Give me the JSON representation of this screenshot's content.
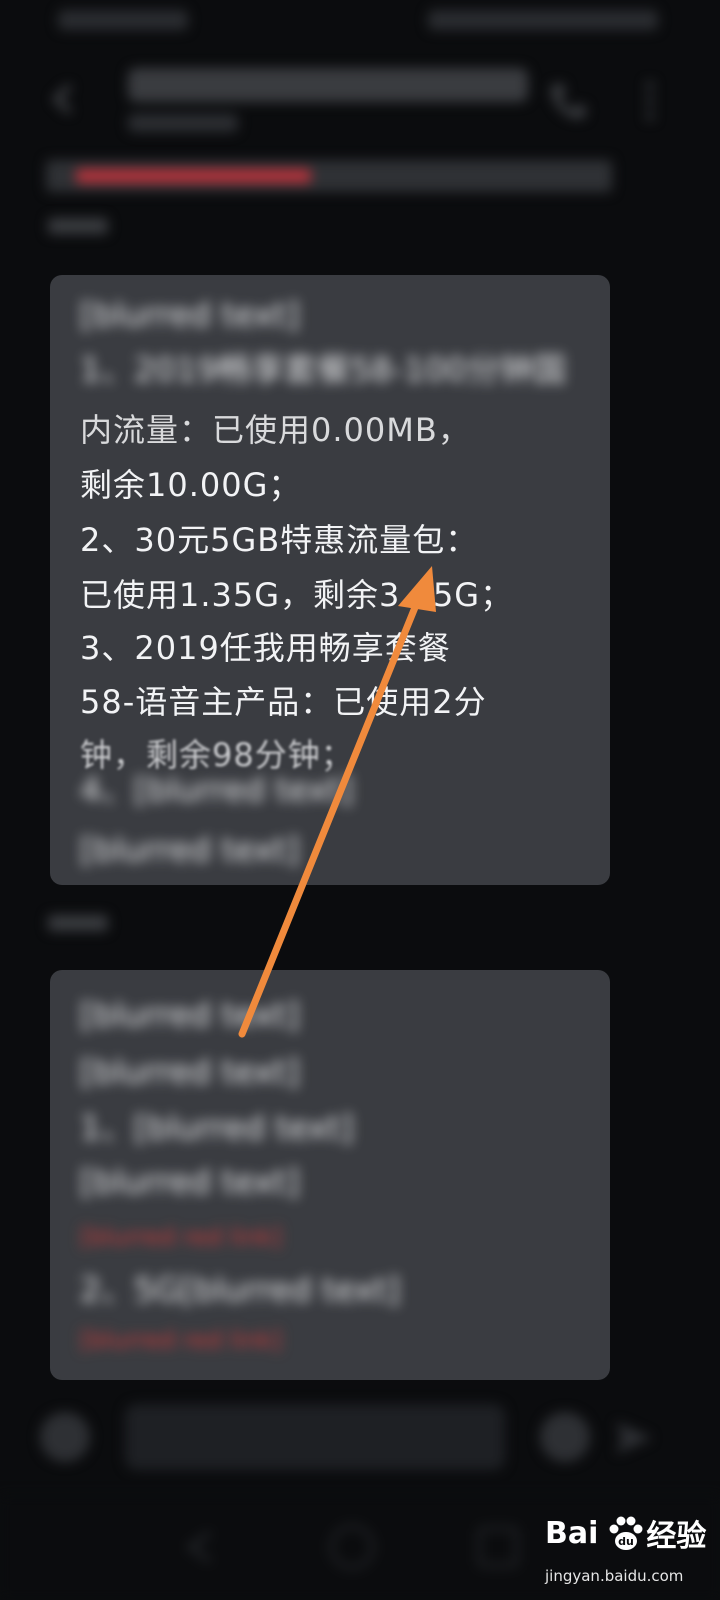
{
  "message_1": {
    "blurred_lines": [
      "[blurred text]",
      "1、2019畅享套餐58-100分钟国"
    ],
    "visible_lines": [
      "内流量：已使用0.00MB，",
      "剩余10.00G；",
      "2、30元5GB特惠流量包：",
      "已使用1.35G，剩余3.65G；",
      "3、2019任我用畅享套餐",
      "58-语音主产品：已使用2分",
      "钟，剩余98分钟；"
    ],
    "blurred_tail": [
      "4、[blurred text]",
      "[blurred text]"
    ]
  },
  "message_2": {
    "blurred_lines": [
      "[blurred text]",
      "[blurred text]",
      "1、[blurred text]",
      "[blurred text]",
      "[blurred red link]",
      "2、5G[blurred text]",
      "[blurred red link]"
    ]
  },
  "input": {
    "placeholder": ""
  },
  "watermark": {
    "brand_left": "Bai",
    "brand_right": "经验",
    "site": "jingyan.baidu.com"
  },
  "colors": {
    "background": "#0b0c0e",
    "bubble": "#3a3c41",
    "arrow": "#f08a3c",
    "accent_red": "#b5323b"
  }
}
